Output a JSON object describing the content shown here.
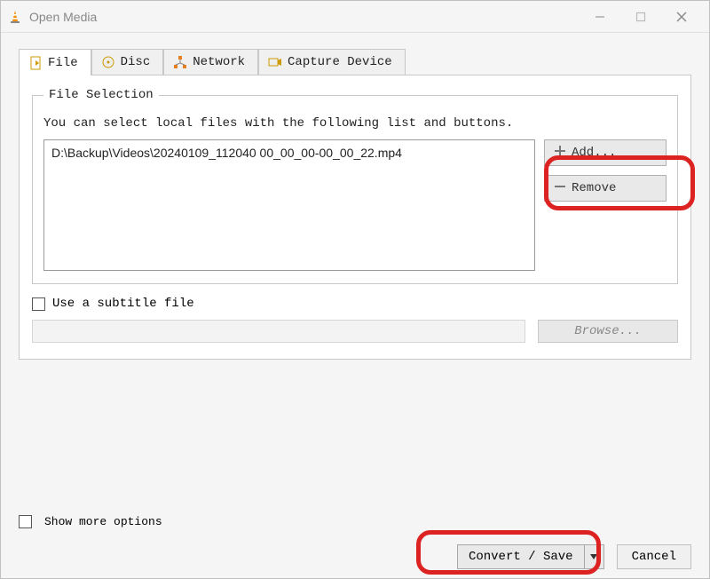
{
  "titlebar": {
    "title": "Open Media"
  },
  "tabs": {
    "file": "File",
    "disc": "Disc",
    "network": "Network",
    "capture": "Capture Device"
  },
  "file_selection": {
    "legend": "File Selection",
    "help": "You can select local files with the following list and buttons.",
    "files": [
      "D:\\Backup\\Videos\\20240109_112040 00_00_00-00_00_22.mp4"
    ],
    "add_label": "Add...",
    "remove_label": "Remove"
  },
  "subtitle": {
    "checkbox_label": "Use a subtitle file",
    "browse_label": "Browse..."
  },
  "footer": {
    "show_more_label": "Show more options",
    "convert_label": "Convert / Save",
    "cancel_label": "Cancel"
  }
}
